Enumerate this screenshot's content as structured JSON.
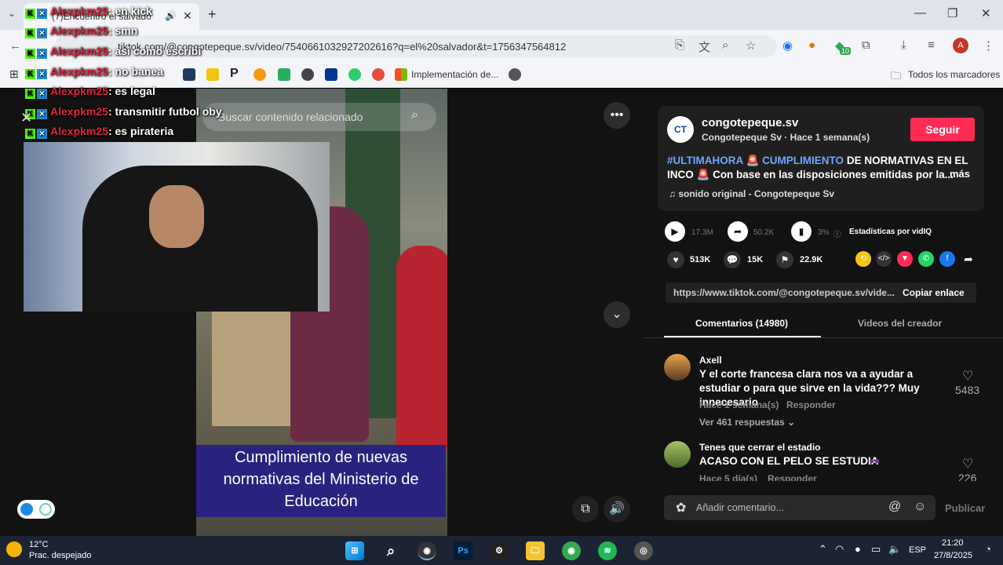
{
  "browser": {
    "tab_title": "(7)Encuentro el salvado",
    "url": "tiktok.com/@congotepeque.sv/video/7540661032927202616?q=el%20salvador&t=1756347564812",
    "bookmark_label": "Implementación de...",
    "all_bookmarks": "Todos los marcadores",
    "avatar_letter": "A",
    "extension_badge": "10"
  },
  "chat": [
    {
      "user": "Alexpkm25",
      "message": ": en kick"
    },
    {
      "user": "Alexpkm25",
      "message": ": smn"
    },
    {
      "user": "Alexpkm25",
      "message": ": asi como escribi"
    },
    {
      "user": "Alexpkm25",
      "message": ": no banea"
    },
    {
      "user": "Alexpkm25",
      "message": ": es legal"
    },
    {
      "user": "Alexpkm25",
      "message": ": transmitir futbol oby"
    },
    {
      "user": "Alexpkm25",
      "message": ": es pirateria"
    }
  ],
  "video": {
    "search_placeholder": "Buscar contenido relacionado",
    "caption": "Cumplimiento de nuevas normativas del Ministerio de Educación"
  },
  "post": {
    "account": "congotepeque.sv",
    "account_sub": "Congotepeque Sv · Hace 1 semana(s)",
    "follow": "Seguir",
    "logo_text": "CT",
    "desc_tag1": "#ULTIMAHORA",
    "desc_tag2": "CUMPLIMIENTO",
    "desc_rest": " DE NORMATIVAS EN EL INCO",
    "desc_line2": " Con base en las disposiciones emitidas por la...",
    "more": "más",
    "sound": "♫  sonido original - Congotepeque Sv",
    "plays": "17.3M",
    "shares_top": "50.2K",
    "pct": "3%",
    "vidiq": "Estadísticas por vidIQ",
    "likes": "513K",
    "comments_count": "15K",
    "saves": "22.9K",
    "link": "https://www.tiktok.com/@congotepeque.sv/vide...",
    "copy_link": "Copiar enlace"
  },
  "tabs": {
    "comments": "Comentarios (14980)",
    "creator": "Videos del creador"
  },
  "comments": [
    {
      "user": "Axell",
      "text": "Y el corte francesa clara nos va a ayudar a estudiar o para que sirve en la vida??? Muy innecesario",
      "time": "Hace 1 semana(s)",
      "reply": "Responder",
      "likes": "5483",
      "replies": "Ver 461 respuestas ⌄"
    },
    {
      "user": "Tenes que cerrar el estadio",
      "text": "ACASO CON EL PELO SE ESTUDIA",
      "time": "Hace 5 día(s)",
      "reply": "Responder",
      "likes": "226"
    }
  ],
  "comment_input": {
    "placeholder": "Añadir comentario...",
    "publish": "Publicar"
  },
  "taskbar": {
    "temp": "12°C",
    "weather": "Prac. despejado",
    "lang": "ESP",
    "time": "21:20",
    "date": "27/8/2025"
  },
  "colors": {
    "tiktok_red": "#fe2c55",
    "hashtag_blue": "#6fa8ff",
    "chat_user_red": "#e0243e",
    "kick_green": "#53fc18",
    "caption_bg": "#29237f"
  }
}
